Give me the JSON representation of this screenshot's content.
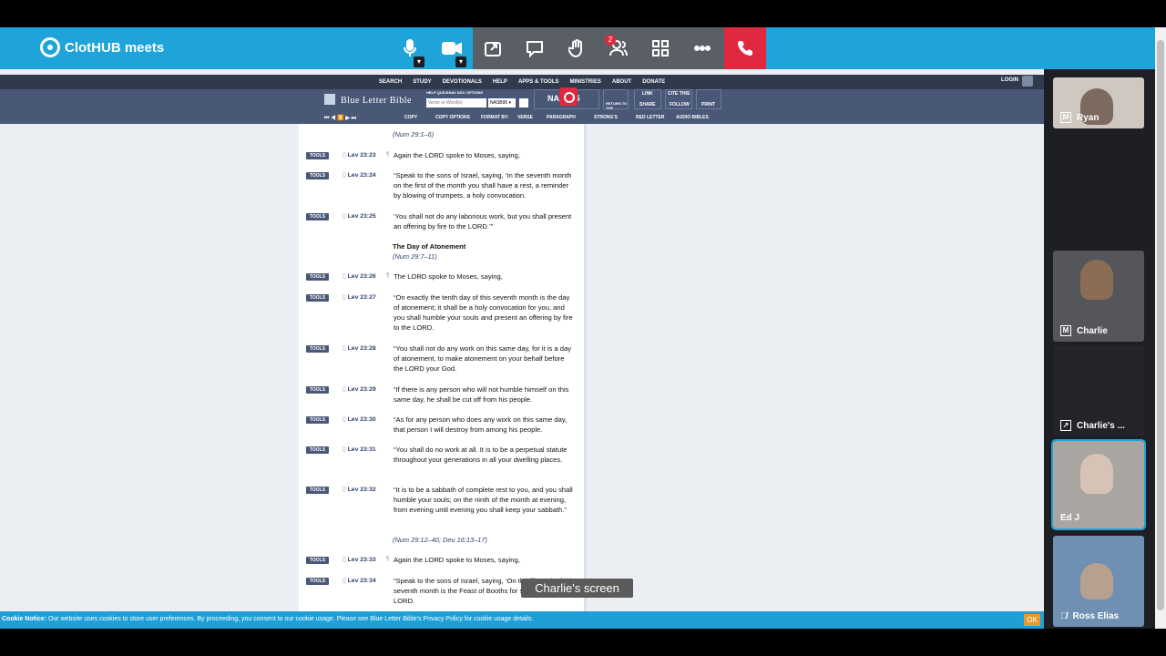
{
  "app": {
    "name": "ClotHUB meets"
  },
  "nav": [
    "SEARCH",
    "STUDY",
    "DEVOTIONALS",
    "HELP",
    "APPS & TOOLS",
    "MINISTRIES",
    "ABOUT",
    "DONATE"
  ],
  "login": "LOGIN",
  "site_title": "Blue Letter Bible",
  "search": {
    "labels": "HELP   QUICKNAV   ADV. OPTIONS",
    "placeholder": "Verse or Word(s)",
    "version": "NASB95 ▾"
  },
  "tool_labels": {
    "link": "LINK",
    "cite": "CITE THIS",
    "share": "SHARE",
    "follow": "FOLLOW",
    "print": "PRINT",
    "return": "RETURN TO TOP",
    "version_box": "NASB95",
    "copy": "COPY",
    "copy_options": "COPY OPTIONS",
    "format": "FORMAT BY:",
    "verse": "VERSE",
    "paragraph": "PARAGRAPH",
    "strongs": "STRONG'S",
    "red_letter": "RED LETTER",
    "audio": "AUDIO BIBLES"
  },
  "top_xref": "(Num 29:1–6)",
  "verses": [
    {
      "ref": "Lev 23:23",
      "pil": "¶",
      "text": "Again the LORD spoke to Moses, saying,"
    },
    {
      "ref": "Lev 23:24",
      "pil": "",
      "text": "“Speak to the sons of Israel, saying, ‘In the seventh month on the first of the month you shall have a rest, a reminder by blowing of trumpets, a holy convocation."
    },
    {
      "ref": "Lev 23:25",
      "pil": "",
      "text": "‘You shall not do any laborious work, but you shall present an offering by fire to the LORD.’”"
    },
    {
      "ref": "Lev 23:26",
      "pil": "¶",
      "text": "The LORD spoke to Moses, saying,"
    },
    {
      "ref": "Lev 23:27",
      "pil": "",
      "text": "“On exactly the tenth day of this seventh month is the day of atonement; it shall be a holy convocation for you, and you shall humble your souls and present an offering by fire to the LORD."
    },
    {
      "ref": "Lev 23:28",
      "pil": "",
      "text": "“You shall not do any work on this same day, for it is a day of atonement, to make atonement on your behalf before the LORD your God."
    },
    {
      "ref": "Lev 23:29",
      "pil": "",
      "text": "“If there is any person who will not humble himself on this same day, he shall be cut off from his people."
    },
    {
      "ref": "Lev 23:30",
      "pil": "",
      "text": "“As for any person who does any work on this same day, that person I will destroy from among his people."
    },
    {
      "ref": "Lev 23:31",
      "pil": "",
      "text": "“You shall do no work at all. It is to be a perpetual statute throughout your generations in all your dwelling places."
    },
    {
      "ref": "Lev 23:32",
      "pil": "",
      "text": "“It is to be a sabbath of complete rest to you, and you shall humble your souls; on the ninth of the month at evening, from evening until evening you shall keep your sabbath.”"
    },
    {
      "ref": "Lev 23:33",
      "pil": "¶",
      "text": "Again the LORD spoke to Moses, saying,"
    },
    {
      "ref": "Lev 23:34",
      "pil": "",
      "text": "“Speak to the sons of Israel, saying, ‘On the fifteenth of this seventh month is the Feast of Booths for seven days to the LORD."
    }
  ],
  "tools_label": "TOOLS",
  "heading_atonement": "The Day of Atonement",
  "xref_atonement": "(Num 29:7–11)",
  "xref_booths": "(Num 29:12–40; Deu 16:13–17)",
  "cookie": {
    "bold": "Cookie Notice:",
    "text": " Our website uses cookies to store user preferences. By proceeding, you consent to our cookie usage. Please see Blue Letter Bible's Privacy Policy for cookie usage details.",
    "ok": "OK"
  },
  "tooltip": "Charlie's screen",
  "participants": {
    "p1": "Ryan",
    "p2": "Charlie",
    "p3": "Charlie's ...",
    "p4": "Ed J",
    "p5": "Ross Elias"
  },
  "participant_badge": "2",
  "m_label": "M"
}
